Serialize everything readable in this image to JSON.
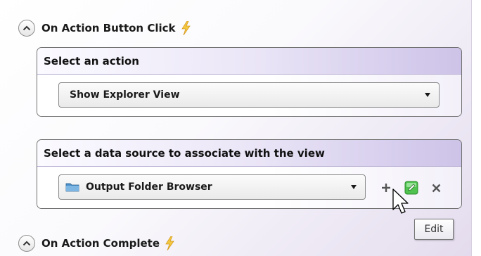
{
  "sections": {
    "action_button_click": {
      "title": "On Action Button Click",
      "collapse_icon": "chevron-up-icon",
      "event_icon": "lightning-icon"
    },
    "action_complete": {
      "title": "On Action Complete",
      "collapse_icon": "chevron-up-icon",
      "event_icon": "lightning-icon"
    }
  },
  "action_group": {
    "header": "Select an action",
    "selected": "Show Explorer View"
  },
  "data_source_group": {
    "header": "Select a data source to associate with the view",
    "selected": "Output Folder Browser",
    "item_icon": "folder-icon",
    "buttons": {
      "add_icon": "plus-icon",
      "edit_icon": "edit-icon",
      "remove_icon": "close-icon"
    }
  },
  "tooltip": {
    "text": "Edit"
  },
  "cursor_icon": "arrow-pointer-icon",
  "colors": {
    "header_gradient_end": "#cdc3e8",
    "bolt": "#f5c842",
    "edit_green": "#4fc24f"
  }
}
